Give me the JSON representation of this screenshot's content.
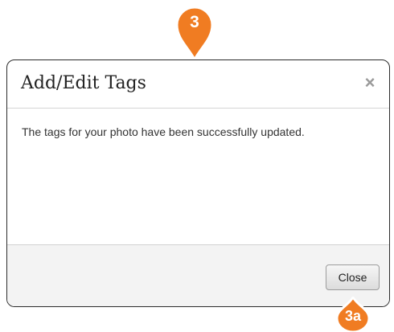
{
  "dialog": {
    "title": "Add/Edit Tags",
    "close_glyph": "×",
    "message": "The tags for your photo have been successfully updated.",
    "close_button_label": "Close"
  },
  "callouts": [
    {
      "label": "3",
      "color": "#f07c22",
      "icon": "location-pin-icon"
    },
    {
      "label": "3a",
      "color": "#f07c22",
      "icon": "location-pin-icon"
    }
  ]
}
